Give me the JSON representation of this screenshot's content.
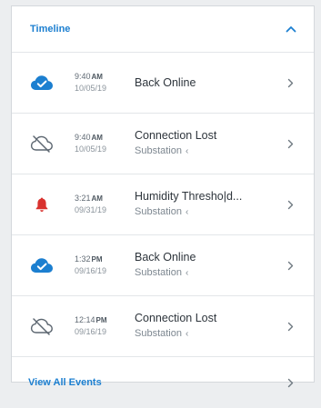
{
  "header": {
    "title": "Timeline",
    "collapse_icon": "chevron-up-icon"
  },
  "events": [
    {
      "icon": "cloud-check-icon",
      "time": "9:40",
      "ampm": "AM",
      "date": "10/05/19",
      "title": "Back Online",
      "subtitle": ""
    },
    {
      "icon": "cloud-off-icon",
      "time": "9:40",
      "ampm": "AM",
      "date": "10/05/19",
      "title": "Connection Lost",
      "subtitle": "Substation"
    },
    {
      "icon": "bell-icon",
      "time": "3:21",
      "ampm": "AM",
      "date": "09/31/19",
      "title": "Humidity Thresho|d...",
      "subtitle": "Substation"
    },
    {
      "icon": "cloud-check-icon",
      "time": "1:32",
      "ampm": "PM",
      "date": "09/16/19",
      "title": "Back Online",
      "subtitle": "Substation"
    },
    {
      "icon": "cloud-off-icon",
      "time": "12:14",
      "ampm": "PM",
      "date": "09/16/19",
      "title": "Connection Lost",
      "subtitle": "Substation"
    }
  ],
  "footer": {
    "link_label": "View All Events"
  },
  "colors": {
    "accent": "#1c7fd0",
    "alarm": "#d9322f",
    "online": "#1c7fd0"
  }
}
